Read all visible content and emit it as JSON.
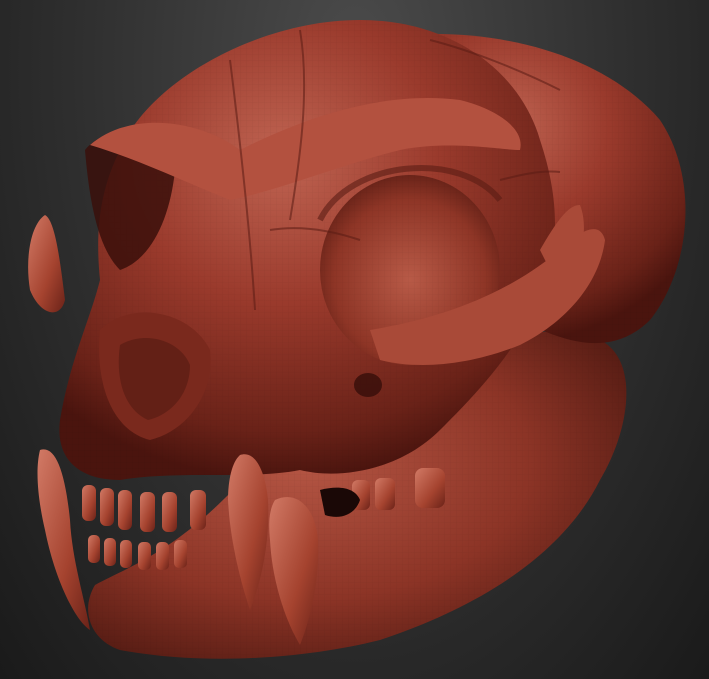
{
  "viewport": {
    "background_top": "#4b4b4b",
    "background_bottom": "#1a1a1a"
  },
  "subject": {
    "material_base": "#9a3a2c",
    "material_light": "#c06452",
    "material_shadow": "#5a1c14",
    "material_deep": "#3a0f0a"
  }
}
